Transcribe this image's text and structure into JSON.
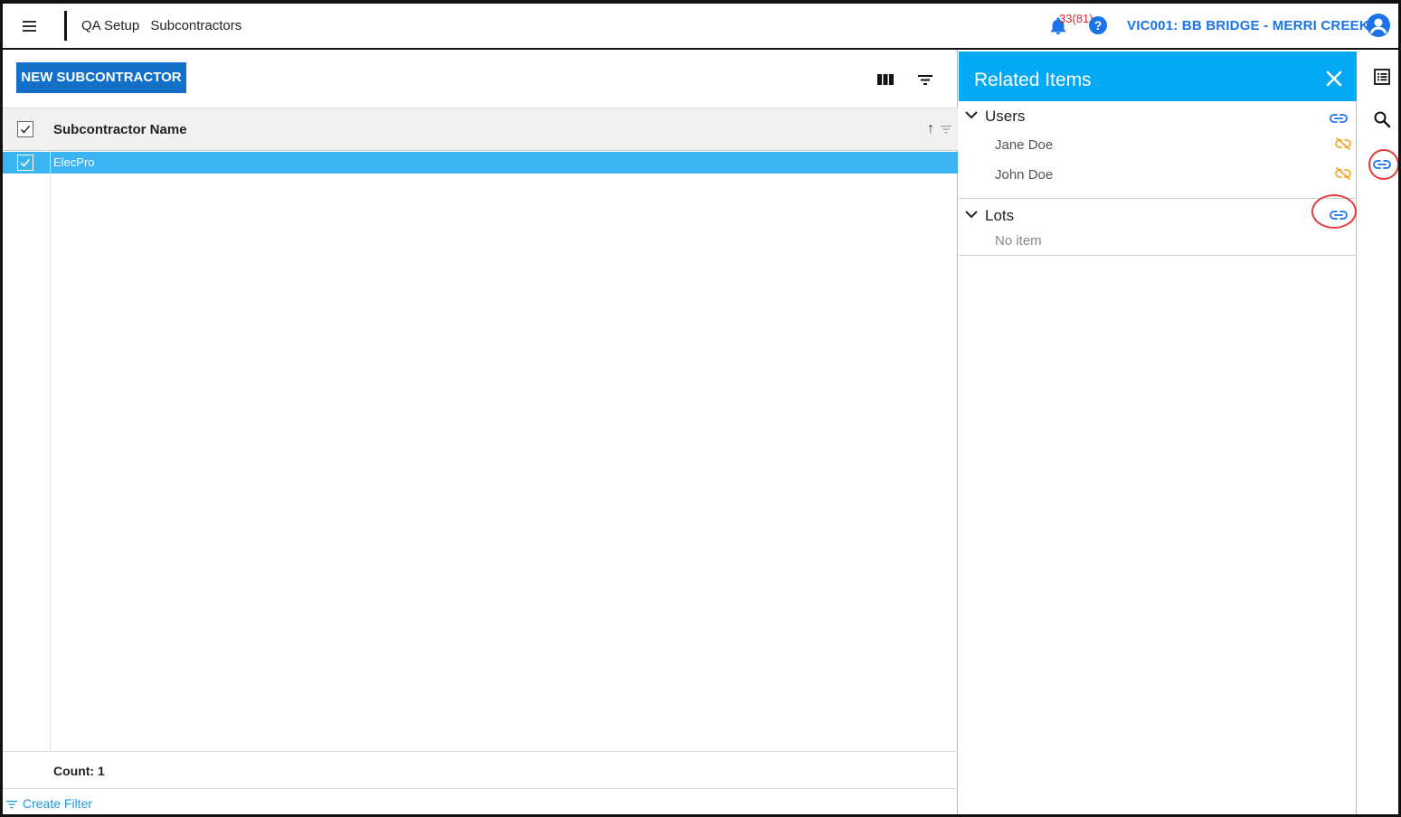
{
  "header": {
    "breadcrumb": [
      "QA Setup",
      "Subcontractors"
    ],
    "notification_count": "33(81)",
    "help_label": "?",
    "project": "VIC001: BB BRIDGE - MERRI CREEK"
  },
  "toolbar": {
    "new_button_label": "NEW SUBCONTRACTOR"
  },
  "grid": {
    "column_header": "Subcontractor Name",
    "sort_glyph": "↑",
    "rows": [
      {
        "name": "ElecPro",
        "selected": true
      }
    ],
    "count_label": "Count: 1",
    "create_filter_label": "Create Filter"
  },
  "related_panel": {
    "title": "Related Items",
    "sections": [
      {
        "title": "Users",
        "items": [
          "Jane Doe",
          "John Doe"
        ]
      },
      {
        "title": "Lots",
        "empty_text": "No item"
      }
    ]
  },
  "colors": {
    "accent": "#1a73e8",
    "panel_header": "#03a9f4",
    "selected_row": "#3bb4f2",
    "unlink_orange": "#f5a623",
    "highlight_ring": "#e23c3c"
  },
  "icons": {
    "rail": [
      "list-icon",
      "search-icon",
      "link-icon"
    ],
    "toolbar": [
      "columns-icon",
      "filter-icon"
    ]
  }
}
